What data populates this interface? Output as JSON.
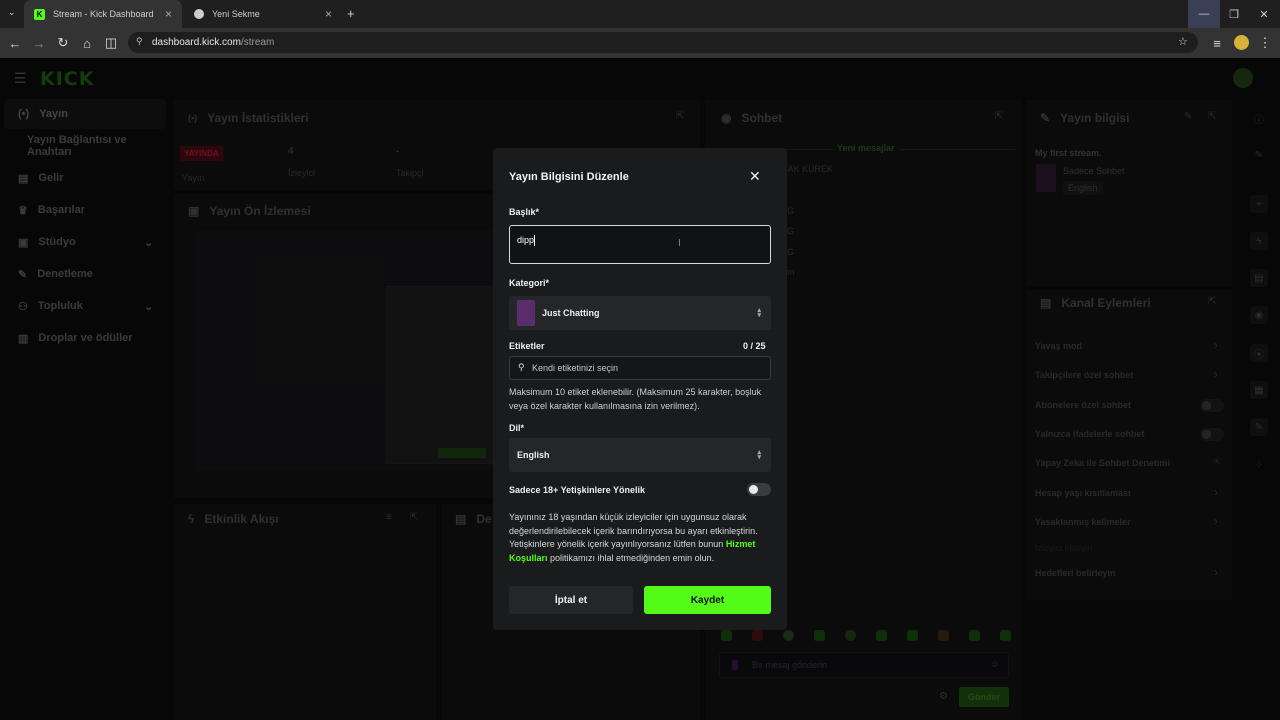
{
  "browser": {
    "tabs": [
      {
        "title": "Stream - Kick Dashboard",
        "active": true
      },
      {
        "title": "Yeni Sekme",
        "active": false
      }
    ],
    "url_domain": "dashboard.kick.com",
    "url_path": "/stream"
  },
  "app": {
    "logo": "KICK",
    "sidebar": {
      "items": [
        {
          "label": "Yayın",
          "icon": "broadcast-icon",
          "active": true
        },
        {
          "label": "Yayın Bağlantısı ve Anahtarı",
          "icon": ""
        },
        {
          "label": "Gelir",
          "icon": "revenue-icon"
        },
        {
          "label": "Başarılar",
          "icon": "trophy-icon"
        },
        {
          "label": "Stüdyo",
          "icon": "studio-icon",
          "expandable": true
        },
        {
          "label": "Denetleme",
          "icon": "wrench-icon"
        },
        {
          "label": "Topluluk",
          "icon": "community-icon",
          "expandable": true
        },
        {
          "label": "Droplar ve ödüller",
          "icon": "drops-icon"
        }
      ]
    },
    "stats": {
      "title": "Yayın İstatistikleri",
      "live_badge": "YAYINDA",
      "stream_label": "Yayın",
      "viewers_value": "4",
      "viewers_label": "İzleyici",
      "followers_value": "-",
      "followers_label": "Takipçi"
    },
    "preview": {
      "title": "Yayın Ön İzlemesi"
    },
    "activity": {
      "title": "Etkinlik Akışı"
    },
    "de_panel": {
      "title": "De"
    },
    "chat": {
      "title": "Sohbet",
      "new_messages": "Yeni mesajlar",
      "msg_fragments": [
        "RAK KÜREK",
        "G",
        "G",
        "G",
        "m"
      ],
      "input_placeholder": "Bir mesaj gönderin",
      "send": "Gönder"
    },
    "stream_info": {
      "title": "Yayın bilgisi",
      "stream_title": "My first stream.",
      "category": "Sadece Sohbet",
      "language": "English"
    },
    "channel_actions": {
      "title": "Kanal Eylemleri",
      "items": [
        {
          "label": "Yavaş mod",
          "control": "chevron"
        },
        {
          "label": "Takipçilere özel sohbet",
          "control": "chevron"
        },
        {
          "label": "Abonelere özel sohbet",
          "control": "toggle"
        },
        {
          "label": "Yalnızca ifadelerle sohbet",
          "control": "toggle"
        },
        {
          "label": "Yapay Zeka ile Sohbet Denetimi",
          "control": "external"
        },
        {
          "label": "Hesap yaşı kısıtlaması",
          "control": "chevron"
        },
        {
          "label": "Yasaklanmış kelimeler",
          "control": "chevron"
        },
        {
          "label": "İzleyici ekleyin",
          "control": "none"
        },
        {
          "label": "Hedefleri belirleyin",
          "control": "chevron"
        }
      ]
    }
  },
  "modal": {
    "title": "Yayın Bilgisini Düzenle",
    "title_label": "Başlık*",
    "title_value": "dipp",
    "category_label": "Kategori*",
    "category_value": "Just Chatting",
    "tags_label": "Etiketler",
    "tags_count": "0 / 25",
    "tags_placeholder": "Kendi etiketinizi seçin",
    "tags_help": "Maksimum 10 etiket eklenebilir. (Maksimum 25 karakter, boşluk veya özel karakter kullanılmasına izin verilmez).",
    "language_label": "Dil*",
    "language_value": "English",
    "adult_label": "Sadece 18+ Yetişkinlere Yönelik",
    "adult_enabled": false,
    "adult_help_1": "Yayınınız 18 yaşından küçük izleyiciler için uygunsuz olarak değerlendirilebilecek içerik barındırıyorsa bu ayarı etkinleştirin. Yetişkinlere yönelik içerik yayınlıyorsanız lütfen bunun",
    "adult_help_link": "Hizmet Koşulları",
    "adult_help_2": "politikamızı ihlal etmediğinden emin olun.",
    "cancel": "İptal et",
    "save": "Kaydet"
  },
  "colors": {
    "accent": "#53fc18",
    "live": "#e0102f",
    "bg": "#0b0b0c",
    "modal_bg": "#1a1b1d"
  }
}
